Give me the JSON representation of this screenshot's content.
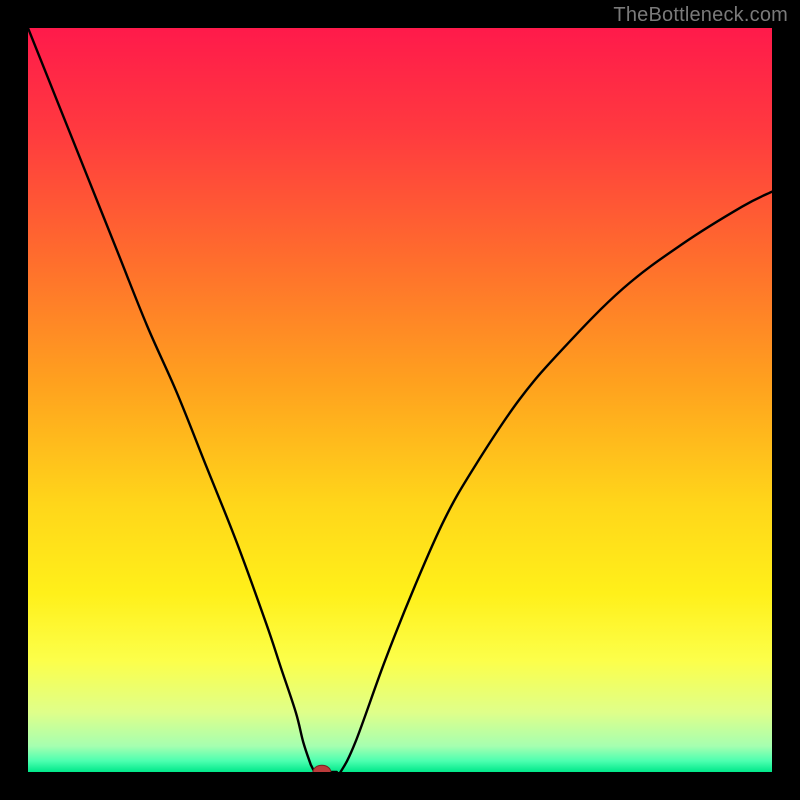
{
  "watermark": "TheBottleneck.com",
  "colors": {
    "frame": "#000000",
    "watermark": "#7a7a7a",
    "gradient_stops": [
      {
        "offset": 0.0,
        "color": "#ff1a4b"
      },
      {
        "offset": 0.14,
        "color": "#ff3a3f"
      },
      {
        "offset": 0.3,
        "color": "#ff6a2e"
      },
      {
        "offset": 0.48,
        "color": "#ffa21e"
      },
      {
        "offset": 0.64,
        "color": "#ffd61a"
      },
      {
        "offset": 0.76,
        "color": "#fff01a"
      },
      {
        "offset": 0.85,
        "color": "#fcff4a"
      },
      {
        "offset": 0.92,
        "color": "#dfff8a"
      },
      {
        "offset": 0.965,
        "color": "#a6ffb0"
      },
      {
        "offset": 0.985,
        "color": "#4dffb0"
      },
      {
        "offset": 1.0,
        "color": "#00e88a"
      }
    ],
    "curve": "#000000",
    "marker_fill": "#bb3b3b",
    "marker_stroke": "#7a1f1f"
  },
  "chart_data": {
    "type": "line",
    "title": "",
    "xlabel": "",
    "ylabel": "",
    "xlim": [
      0,
      100
    ],
    "ylim": [
      0,
      100
    ],
    "grid": false,
    "series": [
      {
        "name": "bottleneck-curve",
        "x": [
          0,
          4,
          8,
          12,
          16,
          20,
          24,
          28,
          32,
          34,
          36,
          37,
          38,
          39,
          40,
          42,
          44,
          48,
          52,
          56,
          60,
          66,
          72,
          80,
          88,
          96,
          100
        ],
        "values": [
          100,
          90,
          80,
          70,
          60,
          51,
          41,
          31,
          20,
          14,
          8,
          4,
          1,
          0,
          0,
          0,
          4,
          15,
          25,
          34,
          41,
          50,
          57,
          65,
          71,
          76,
          78
        ]
      }
    ],
    "marker": {
      "x": 39.5,
      "y": 0,
      "rx": 1.2,
      "ry": 0.9
    },
    "flat_min": {
      "x_start": 38.5,
      "x_end": 41.5,
      "y": 0
    }
  }
}
